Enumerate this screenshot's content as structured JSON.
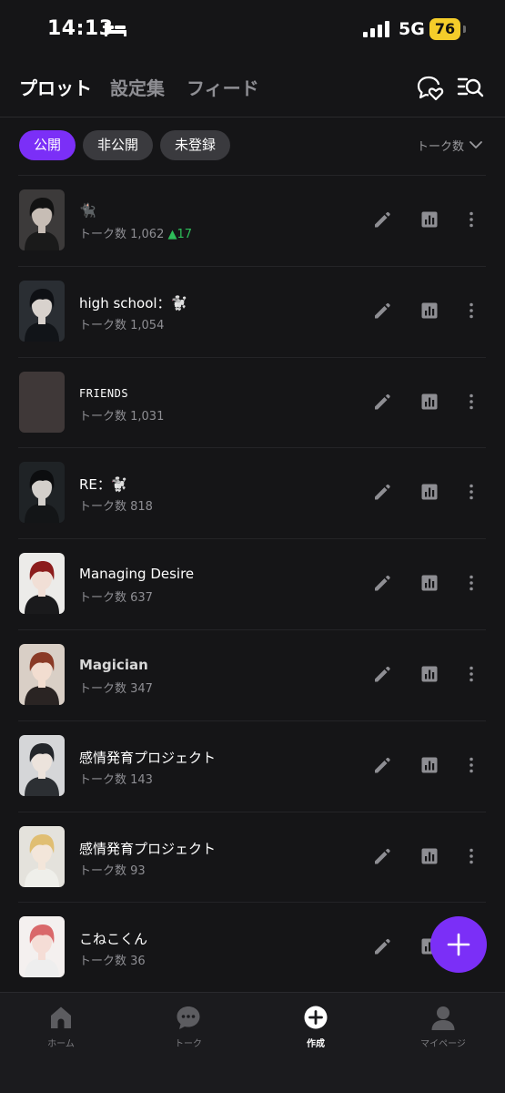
{
  "status_bar": {
    "time": "14:13",
    "network": "5G",
    "battery": "76"
  },
  "header": {
    "tabs": [
      {
        "label": "プロット",
        "active": true
      },
      {
        "label": "設定集",
        "active": false
      },
      {
        "label": "フィード",
        "active": false
      }
    ],
    "icons": [
      "heart-chat-icon",
      "search-list-icon"
    ]
  },
  "filters": {
    "chips": [
      "公開",
      "非公開",
      "未登録"
    ],
    "selected": "公開",
    "sort_label": "トーク数"
  },
  "plots": [
    {
      "title": "🐈‍⬛",
      "count_label": "トーク数 1,062",
      "delta": "▲17",
      "thumb": {
        "bg": "#3c3a3a",
        "hair": "#121212",
        "skin": "#c7bdb5",
        "cloth": "#1a1a1a"
      }
    },
    {
      "title": "high school：🐩",
      "count_label": "トーク数 1,054",
      "delta": "",
      "thumb": {
        "bg": "#2a2e33",
        "hair": "#0e1014",
        "skin": "#d8d2cd",
        "cloth": "#111418"
      }
    },
    {
      "title": "FRIENDS",
      "count_label": "トーク数 1,031",
      "delta": "",
      "thumb": {
        "bg": "#3f3838",
        "hair": "#3f3838",
        "skin": "#3f3838",
        "cloth": "#3f3838"
      }
    },
    {
      "title": "RE：🐩",
      "count_label": "トーク数 818",
      "delta": "",
      "thumb": {
        "bg": "#1f2326",
        "hair": "#0c0d0f",
        "skin": "#d3cfcb",
        "cloth": "#131517"
      }
    },
    {
      "title": "Managing Desire",
      "count_label": "トーク数 637",
      "delta": "",
      "thumb": {
        "bg": "#ecebe9",
        "hair": "#8c1c1c",
        "skin": "#f1dfd6",
        "cloth": "#1a1a1c"
      }
    },
    {
      "title": "Magician",
      "count_label": "トーク数 347",
      "delta": "",
      "thumb": {
        "bg": "#d9cfc6",
        "hair": "#8a3a26",
        "skin": "#f2ddd0",
        "cloth": "#2a2423"
      }
    },
    {
      "title": "感情発育プロジェクト",
      "count_label": "トーク数 143",
      "delta": "",
      "thumb": {
        "bg": "#d5d6d8",
        "hair": "#23262a",
        "skin": "#ece3dc",
        "cloth": "#2c2f33"
      }
    },
    {
      "title": "感情発育プロジェクト",
      "count_label": "トーク数 93",
      "delta": "",
      "thumb": {
        "bg": "#e4e2dc",
        "hair": "#e0be72",
        "skin": "#f3e6da",
        "cloth": "#efefea"
      }
    },
    {
      "title": "こねこくん",
      "count_label": "トーク数 36",
      "delta": "",
      "thumb": {
        "bg": "#f4f0ef",
        "hair": "#d9686a",
        "skin": "#f5ddd6",
        "cloth": "#eeeeee"
      }
    }
  ],
  "fab": {
    "icon": "plus-icon"
  },
  "bottom_nav": [
    {
      "label": "ホーム",
      "icon": "home-icon",
      "active": false
    },
    {
      "label": "トーク",
      "icon": "chat-icon",
      "active": false
    },
    {
      "label": "作成",
      "icon": "plus-circle-icon",
      "active": true
    },
    {
      "label": "マイページ",
      "icon": "person-icon",
      "active": false
    }
  ],
  "colors": {
    "accent": "#7b2ff7",
    "background": "#151517",
    "up": "#2ebd59",
    "battery": "#f4cd2a"
  }
}
